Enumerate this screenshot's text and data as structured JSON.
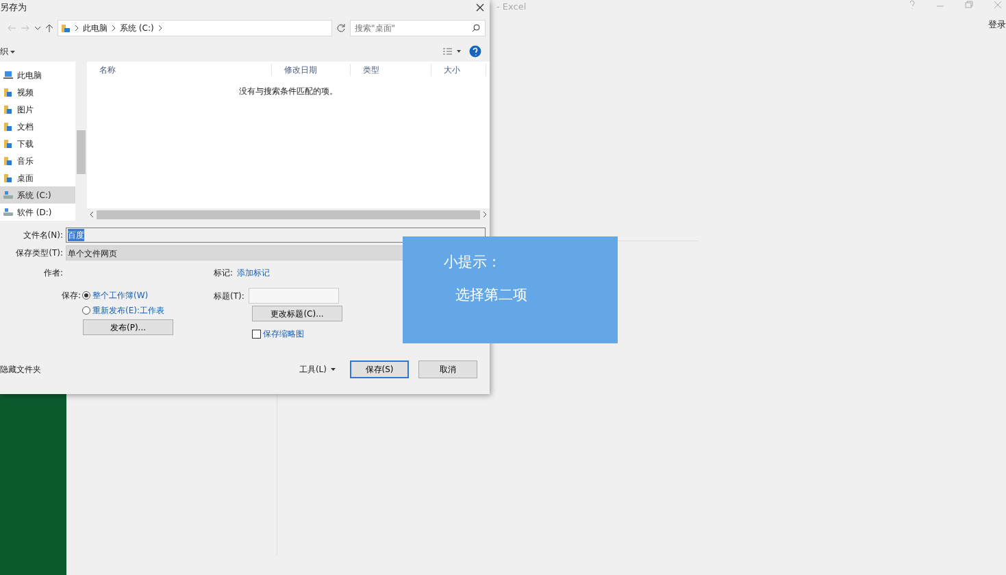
{
  "app_window": {
    "title": "- Excel",
    "sign_in": "登录"
  },
  "dialog": {
    "title": "另存为",
    "address": [
      "此电脑",
      "系统 (C:)"
    ],
    "search": {
      "placeholder": "搜索\"桌面\""
    },
    "organize": "织",
    "nav": [
      {
        "label": "此电脑",
        "kind": "pc",
        "selected": false
      },
      {
        "label": "视频",
        "kind": "folder",
        "selected": false
      },
      {
        "label": "图片",
        "kind": "folder",
        "selected": false
      },
      {
        "label": "文档",
        "kind": "folder",
        "selected": false
      },
      {
        "label": "下载",
        "kind": "folder",
        "selected": false
      },
      {
        "label": "音乐",
        "kind": "folder",
        "selected": false
      },
      {
        "label": "桌面",
        "kind": "folder",
        "selected": false
      },
      {
        "label": "系统 (C:)",
        "kind": "drive",
        "selected": true
      },
      {
        "label": "软件 (D:)",
        "kind": "drive",
        "selected": false
      }
    ],
    "columns": [
      "名称",
      "修改日期",
      "类型",
      "大小"
    ],
    "empty_message": "没有与搜索条件匹配的项。",
    "filename_label": "文件名(N):",
    "filename": "百度",
    "type_label": "保存类型(T):",
    "type": "单个文件网页",
    "author_label": "作者:",
    "tags_label": "标记:",
    "tags_link": "添加标记",
    "save_label": "保存:",
    "save_options": [
      {
        "label": "整个工作簿(W)",
        "selected": true
      },
      {
        "label": "重新发布(E):工作表",
        "selected": false
      }
    ],
    "publish_button": "发布(P)...",
    "title_label": "标题(T):",
    "change_title_button": "更改标题(C)...",
    "thumbnail": {
      "label": "保存缩略图",
      "checked": false
    },
    "hide_folders": "隐藏文件夹",
    "tools": "工具(L)",
    "buttons": [
      {
        "label": "保存(S)",
        "default": true
      },
      {
        "label": "取消",
        "default": false
      }
    ]
  },
  "tip": {
    "title": "小提示：",
    "text": "选择第二项"
  }
}
